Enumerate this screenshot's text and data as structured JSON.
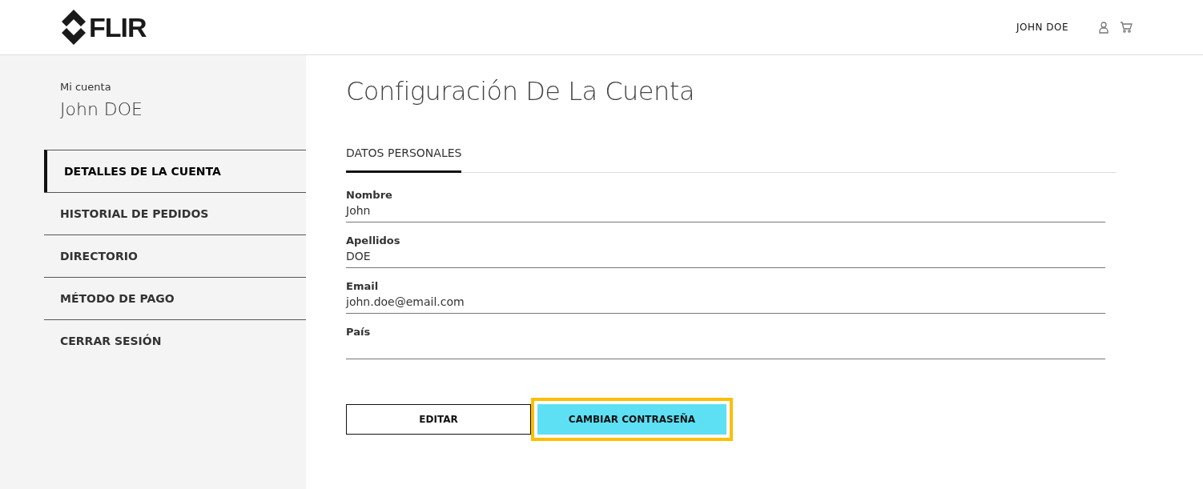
{
  "header": {
    "logo": "FLIR",
    "user_name": "JOHN DOE"
  },
  "sidebar": {
    "caption": "Mi cuenta",
    "name": "John DOE",
    "items": [
      {
        "label": "DETALLES DE LA CUENTA",
        "selected": true
      },
      {
        "label": "HISTORIAL DE PEDIDOS",
        "selected": false
      },
      {
        "label": "DIRECTORIO",
        "selected": false
      },
      {
        "label": "MÉTODO DE PAGO",
        "selected": false
      },
      {
        "label": "CERRAR SESIÓN",
        "selected": false
      }
    ]
  },
  "page_title": "Configuración De La Cuenta",
  "tabs": [
    {
      "label": "DATOS PERSONALES",
      "selected": true
    }
  ],
  "fields": [
    {
      "label": "Nombre",
      "value": "John"
    },
    {
      "label": "Apellidos",
      "value": "DOE"
    },
    {
      "label": "Email",
      "value": "john.doe@email.com"
    },
    {
      "label": "País"
    }
  ],
  "buttons": [
    {
      "label": "EDITAR",
      "kind": "outline",
      "highlighted": false
    },
    {
      "label": "CAMBIAR CONTRASEÑA",
      "kind": "primary",
      "highlighted": true
    }
  ]
}
